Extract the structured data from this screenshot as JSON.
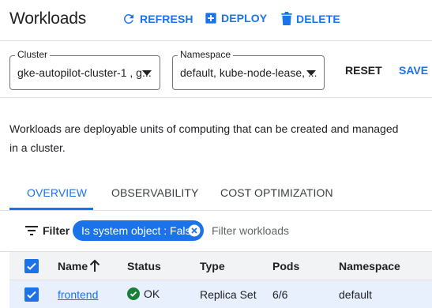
{
  "header": {
    "title": "Workloads",
    "refresh_label": "REFRESH",
    "deploy_label": "DEPLOY",
    "delete_label": "DELETE"
  },
  "filters": {
    "cluster": {
      "label": "Cluster",
      "value": "gke-autopilot-cluster-1 , g..."
    },
    "namespace": {
      "label": "Namespace",
      "value": "default, kube-node-lease, ..."
    },
    "reset_label": "RESET",
    "save_label": "SAVE"
  },
  "description": "Workloads are deployable units of computing that can be created and managed in a cluster.",
  "tabs": [
    {
      "label": "OVERVIEW",
      "active": true
    },
    {
      "label": "OBSERVABILITY",
      "active": false
    },
    {
      "label": "COST OPTIMIZATION",
      "active": false
    }
  ],
  "filterbar": {
    "label": "Filter",
    "chip": "Is system object : False",
    "placeholder": "Filter workloads"
  },
  "table": {
    "columns": [
      "Name",
      "Status",
      "Type",
      "Pods",
      "Namespace"
    ],
    "rows": [
      {
        "name": "frontend",
        "status": "OK",
        "type": "Replica Set",
        "pods": "6/6",
        "namespace": "default"
      }
    ]
  },
  "colors": {
    "accent": "#1a73e8",
    "status_ok": "#188038",
    "selected_row": "#e8f0fe"
  }
}
